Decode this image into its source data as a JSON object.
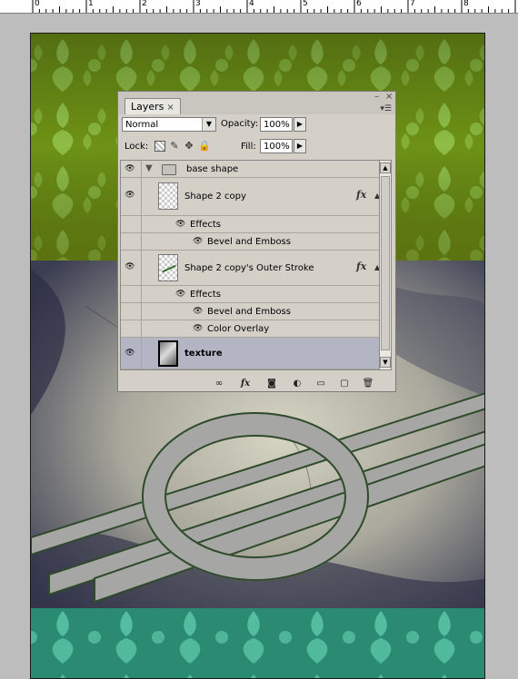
{
  "ruler": {
    "numbers": [
      "0",
      "1",
      "2",
      "3",
      "4",
      "5",
      "6",
      "7",
      "8"
    ]
  },
  "panel": {
    "tab_label": "Layers",
    "tab_close": "×",
    "minimize": "–",
    "close": "×",
    "blend_mode": "Normal",
    "opacity_label": "Opacity:",
    "opacity_value": "100%",
    "lock_label": "Lock:",
    "fill_label": "Fill:",
    "fill_value": "100%",
    "layers": {
      "group": {
        "name": "base shape"
      },
      "shape_copy": {
        "name": "Shape 2 copy",
        "effects_label": "Effects",
        "effects": [
          "Bevel and Emboss"
        ]
      },
      "outer_stroke": {
        "name": "Shape 2 copy's Outer Stroke",
        "effects_label": "Effects",
        "effects": [
          "Bevel and Emboss",
          "Color Overlay"
        ]
      },
      "texture": {
        "name": "texture"
      }
    },
    "fx_label": "fx"
  },
  "colors": {
    "top_band": "#6e9216",
    "bottom_band": "#2b8a72",
    "selected_row": "#b3b5c4",
    "shape_fill": "#a6a7a4"
  }
}
